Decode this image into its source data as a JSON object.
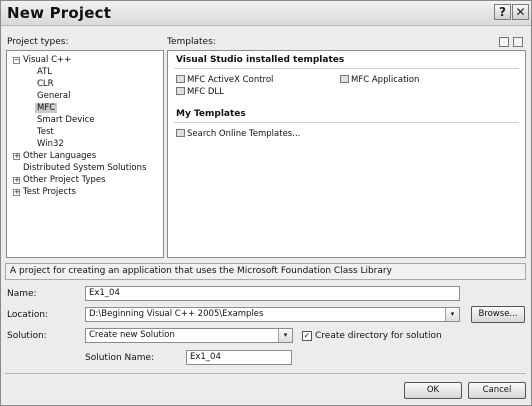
{
  "window": {
    "title": "New Project",
    "help_glyph": "?",
    "close_glyph": "✕"
  },
  "project_types": {
    "label": "Project types:",
    "items": [
      {
        "label": "Visual C++",
        "expander": "−"
      },
      {
        "label": "ATL"
      },
      {
        "label": "CLR"
      },
      {
        "label": "General"
      },
      {
        "label": "MFC"
      },
      {
        "label": "Smart Device"
      },
      {
        "label": "Test"
      },
      {
        "label": "Win32"
      },
      {
        "label": "Other Languages",
        "expander": "+"
      },
      {
        "label": "Distributed System Solutions"
      },
      {
        "label": "Other Project Types",
        "expander": "+"
      },
      {
        "label": "Test Projects",
        "expander": "+"
      }
    ],
    "selected": "MFC"
  },
  "templates": {
    "label": "Templates:",
    "installed_heading": "Visual Studio installed templates",
    "installed": [
      {
        "label": "MFC ActiveX Control"
      },
      {
        "label": "MFC DLL"
      },
      {
        "label": "MFC Application"
      }
    ],
    "my_heading": "My Templates",
    "my": [
      {
        "label": "Search Online Templates..."
      }
    ]
  },
  "description": "A project for creating an application that uses the Microsoft Foundation Class Library",
  "form": {
    "name_label": "Name:",
    "name_value": "Ex1_04",
    "location_label": "Location:",
    "location_value": "D:\\Beginning Visual C++ 2005\\Examples",
    "browse_label": "Browse...",
    "solution_label": "Solution:",
    "solution_value": "Create new Solution",
    "create_dir_label": "Create directory for solution",
    "create_dir_checked": true,
    "solution_name_label": "Solution Name:",
    "solution_name_value": "Ex1_04"
  },
  "buttons": {
    "ok": "OK",
    "cancel": "Cancel"
  },
  "icons": {
    "dropdown": "▾",
    "check": "✓"
  }
}
